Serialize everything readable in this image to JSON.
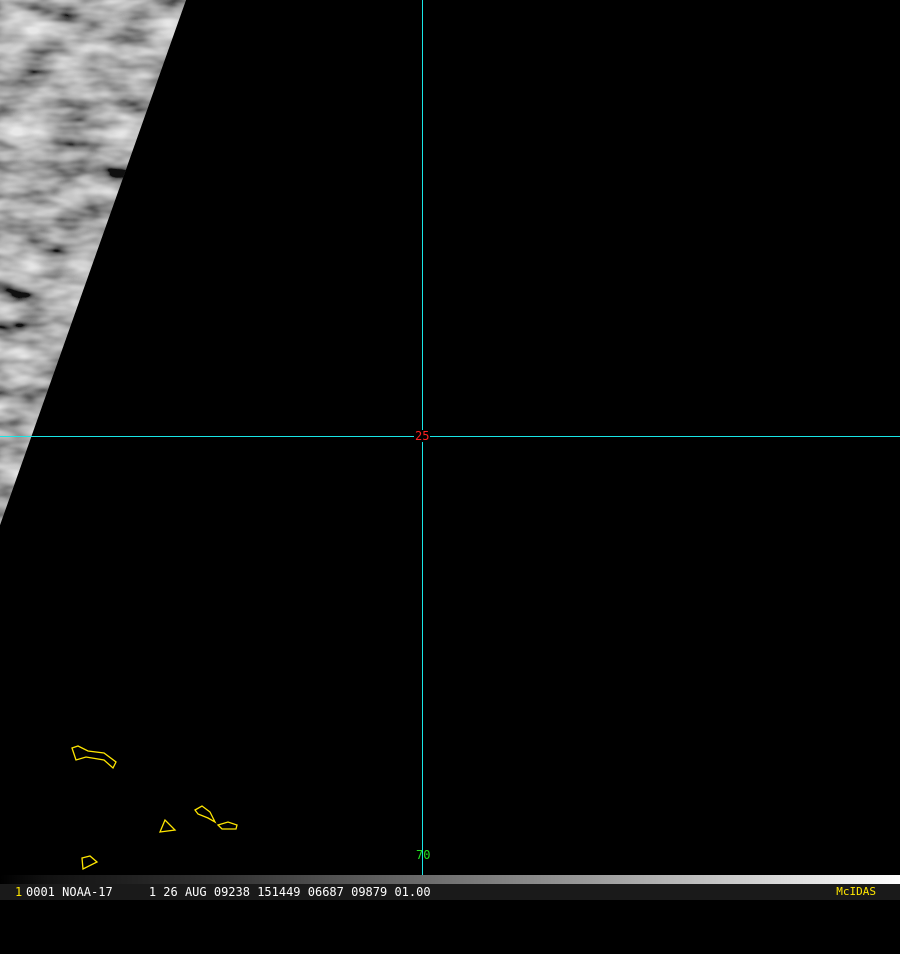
{
  "overlay": {
    "lat_label": "25",
    "lon_label": "70",
    "grid_color": "#19e6e6",
    "coast_color": "#ffe600"
  },
  "infobar": {
    "frame_number": "1",
    "text": "0001 NOAA-17     1 26 AUG 09238 151449 06687 09879 01.00",
    "brand": "McIDAS"
  }
}
